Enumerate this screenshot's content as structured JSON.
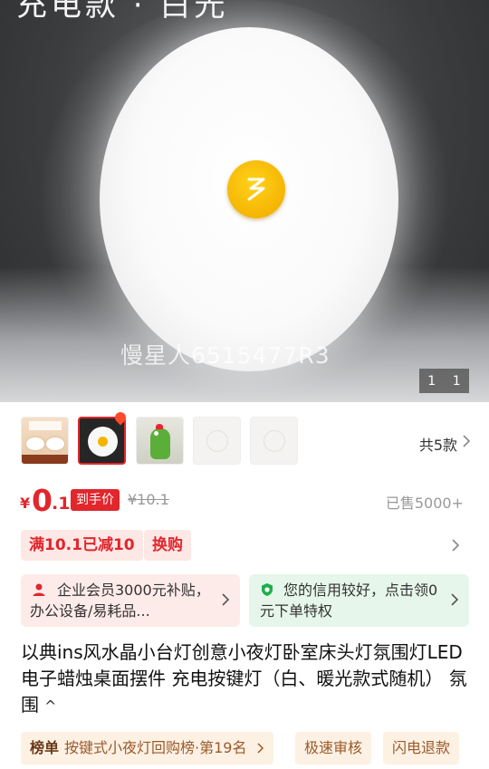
{
  "hero": {
    "top_text": "充电款 · 白光",
    "watermark": "慢星人6515477R3",
    "counter_current": "1",
    "counter_total": "1"
  },
  "variants": {
    "total_label": "共5款",
    "items": [
      "variant-1",
      "variant-2",
      "variant-3",
      "variant-4",
      "variant-5"
    ],
    "selected_index": 1
  },
  "price": {
    "currency": "¥",
    "integer": "0",
    "decimal": ".1",
    "deal_tag": "到手价",
    "original": "¥10.1",
    "sold": "已售5000+"
  },
  "promos": [
    "满10.1已减10",
    "换购"
  ],
  "benefits": {
    "enterprise": "企业会员3000元补贴，办公设备/易耗品...",
    "credit": "您的信用较好，点击领0元下单特权"
  },
  "title": {
    "text": "以典ins风水晶小台灯创意小夜灯卧室床头灯氛围灯LED电子蜡烛桌面摆件 充电按键灯（白、暖光款式随机） 氛围",
    "caret": "^"
  },
  "badges": {
    "rank_label": "榜单",
    "rank_text": "按键式小夜灯回购榜·第19名",
    "fast_review": "极速审核",
    "fast_refund": "闪电退款"
  },
  "colors": {
    "accent": "#e1262c",
    "promo_bg": "#fde8e6",
    "credit_bg": "#e6f6ea",
    "badge_bg": "#fdf1e4",
    "lamp_button": "#f5b400"
  }
}
